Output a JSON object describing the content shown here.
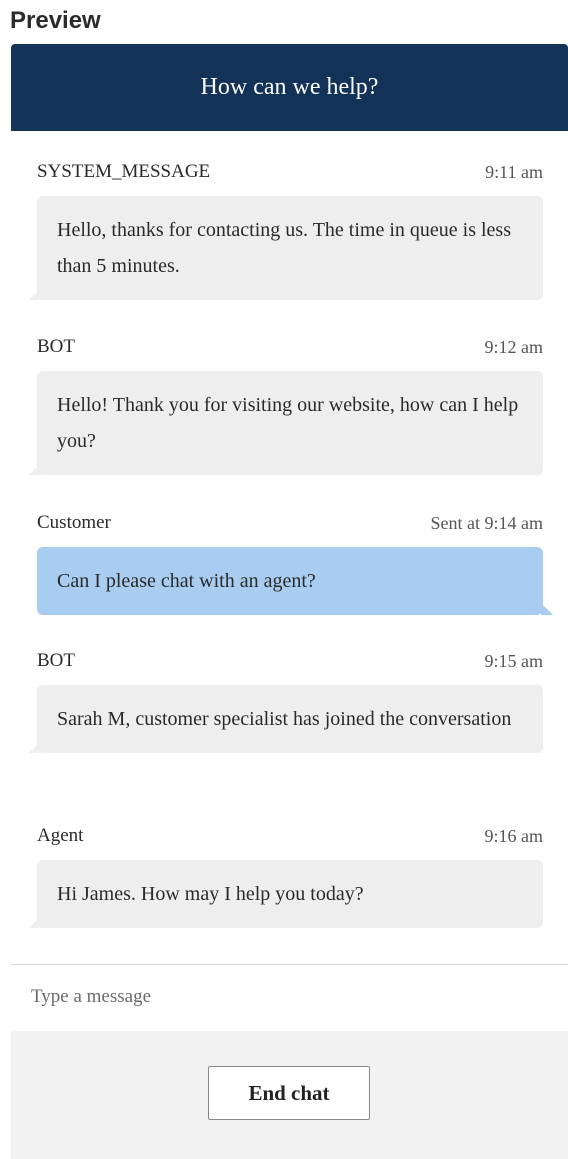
{
  "preview_label": "Preview",
  "header": {
    "title": "How can we help?"
  },
  "messages": [
    {
      "sender": "SYSTEM_MESSAGE",
      "time": "9:11 am",
      "text": "Hello, thanks for contacting us. The time in queue is less than 5 minutes."
    },
    {
      "sender": "BOT",
      "time": "9:12 am",
      "text": "Hello! Thank you for visiting our website, how can I help you?"
    },
    {
      "sender": "Customer",
      "time": "Sent at 9:14 am",
      "text": "Can I please chat with an agent?"
    },
    {
      "sender": "BOT",
      "time": "9:15 am",
      "text": "Sarah M, customer specialist has joined the conversation"
    },
    {
      "sender": "Agent",
      "time": "9:16 am",
      "text": "Hi James. How may I help you today?"
    }
  ],
  "composer": {
    "placeholder": "Type a message"
  },
  "footer": {
    "end_chat_label": "End chat"
  },
  "colors": {
    "header_bg": "#123258",
    "customer_bubble": "#a9cdf0",
    "other_bubble": "#eeeeee"
  }
}
